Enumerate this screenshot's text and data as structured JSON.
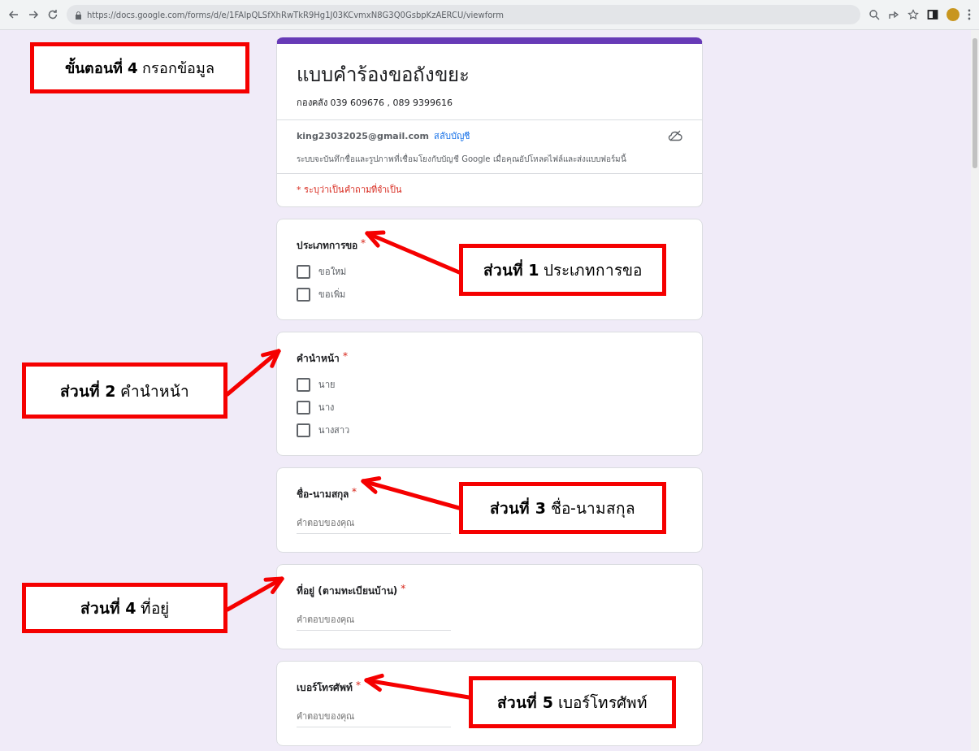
{
  "browser": {
    "url": "https://docs.google.com/forms/d/e/1FAIpQLSfXhRwTkR9Hg1J03KCvmxN8G3Q0GsbpKzAERCU/viewform"
  },
  "form": {
    "title": "แบบคำร้องขอถังขยะ",
    "description": "กองคลัง 039 609676 , 089 9399616",
    "account": {
      "email": "king23032025@gmail.com",
      "switch_link": "สลับบัญชี"
    },
    "notice": "ระบบจะบันทึกชื่อและรูปภาพที่เชื่อมโยงกับบัญชี Google เมื่อคุณอัปโหลดไฟล์และส่งแบบฟอร์มนี้",
    "required_note": "* ระบุว่าเป็นคำถามที่จำเป็น",
    "questions": [
      {
        "kind": "checkbox",
        "label": "ประเภทการขอ",
        "required_mark": "*",
        "options": [
          {
            "label": "ขอใหม่",
            "checked": false
          },
          {
            "label": "ขอเพิ่ม",
            "checked": false
          }
        ]
      },
      {
        "kind": "checkbox",
        "label": "คำนำหน้า",
        "required_mark": "*",
        "options": [
          {
            "label": "นาย",
            "checked": false
          },
          {
            "label": "นาง",
            "checked": false
          },
          {
            "label": "นางสาว",
            "checked": false
          }
        ]
      },
      {
        "kind": "text",
        "label": "ชื่อ-นามสกุล",
        "required_mark": "*",
        "placeholder": "คำตอบของคุณ"
      },
      {
        "kind": "text",
        "label": "ที่อยู่ (ตามทะเบียนบ้าน)",
        "required_mark": "*",
        "placeholder": "คำตอบของคุณ"
      },
      {
        "kind": "text",
        "label": "เบอร์โทรศัพท์",
        "required_mark": "*",
        "placeholder": "คำตอบของคุณ"
      }
    ]
  },
  "annotations": [
    {
      "kind": "step",
      "text": "**ขั้นตอนที่ 4** กรอกข้อมูล"
    },
    {
      "kind": "callout",
      "text": "**ส่วนที่ 1** ประเภทการขอ"
    },
    {
      "kind": "callout",
      "text": "**ส่วนที่ 2** คำนำหน้า"
    },
    {
      "kind": "callout",
      "text": "**ส่วนที่ 3** ชื่อ-นามสกุล"
    },
    {
      "kind": "callout",
      "text": "**ส่วนที่ 4** ที่อยู่"
    },
    {
      "kind": "callout",
      "text": "**ส่วนที่ 5** เบอร์โทรศัพท์"
    }
  ]
}
